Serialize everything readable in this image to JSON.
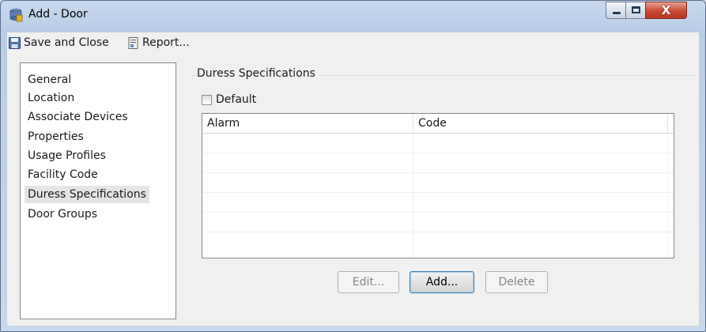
{
  "window": {
    "title": "Add - Door",
    "close_glyph": "X"
  },
  "toolbar": {
    "save_label": "Save and Close",
    "report_label": "Report..."
  },
  "nav": {
    "items": [
      {
        "label": "General",
        "selected": false
      },
      {
        "label": "Location",
        "selected": false
      },
      {
        "label": "Associate Devices",
        "selected": false
      },
      {
        "label": "Properties",
        "selected": false
      },
      {
        "label": "Usage Profiles",
        "selected": false
      },
      {
        "label": "Facility Code",
        "selected": false
      },
      {
        "label": "Duress Specifications",
        "selected": true
      },
      {
        "label": "Door Groups",
        "selected": false
      }
    ]
  },
  "main": {
    "group_title": "Duress Specifications",
    "default_label": "Default",
    "default_checked": false,
    "grid": {
      "columns": [
        "Alarm",
        "Code"
      ],
      "rows": []
    },
    "buttons": {
      "edit": "Edit...",
      "add": "Add...",
      "delete": "Delete"
    }
  },
  "colors": {
    "titlebar": "#c8d9ee",
    "close_button": "#c94a31",
    "selection": "#e4e4e4"
  }
}
